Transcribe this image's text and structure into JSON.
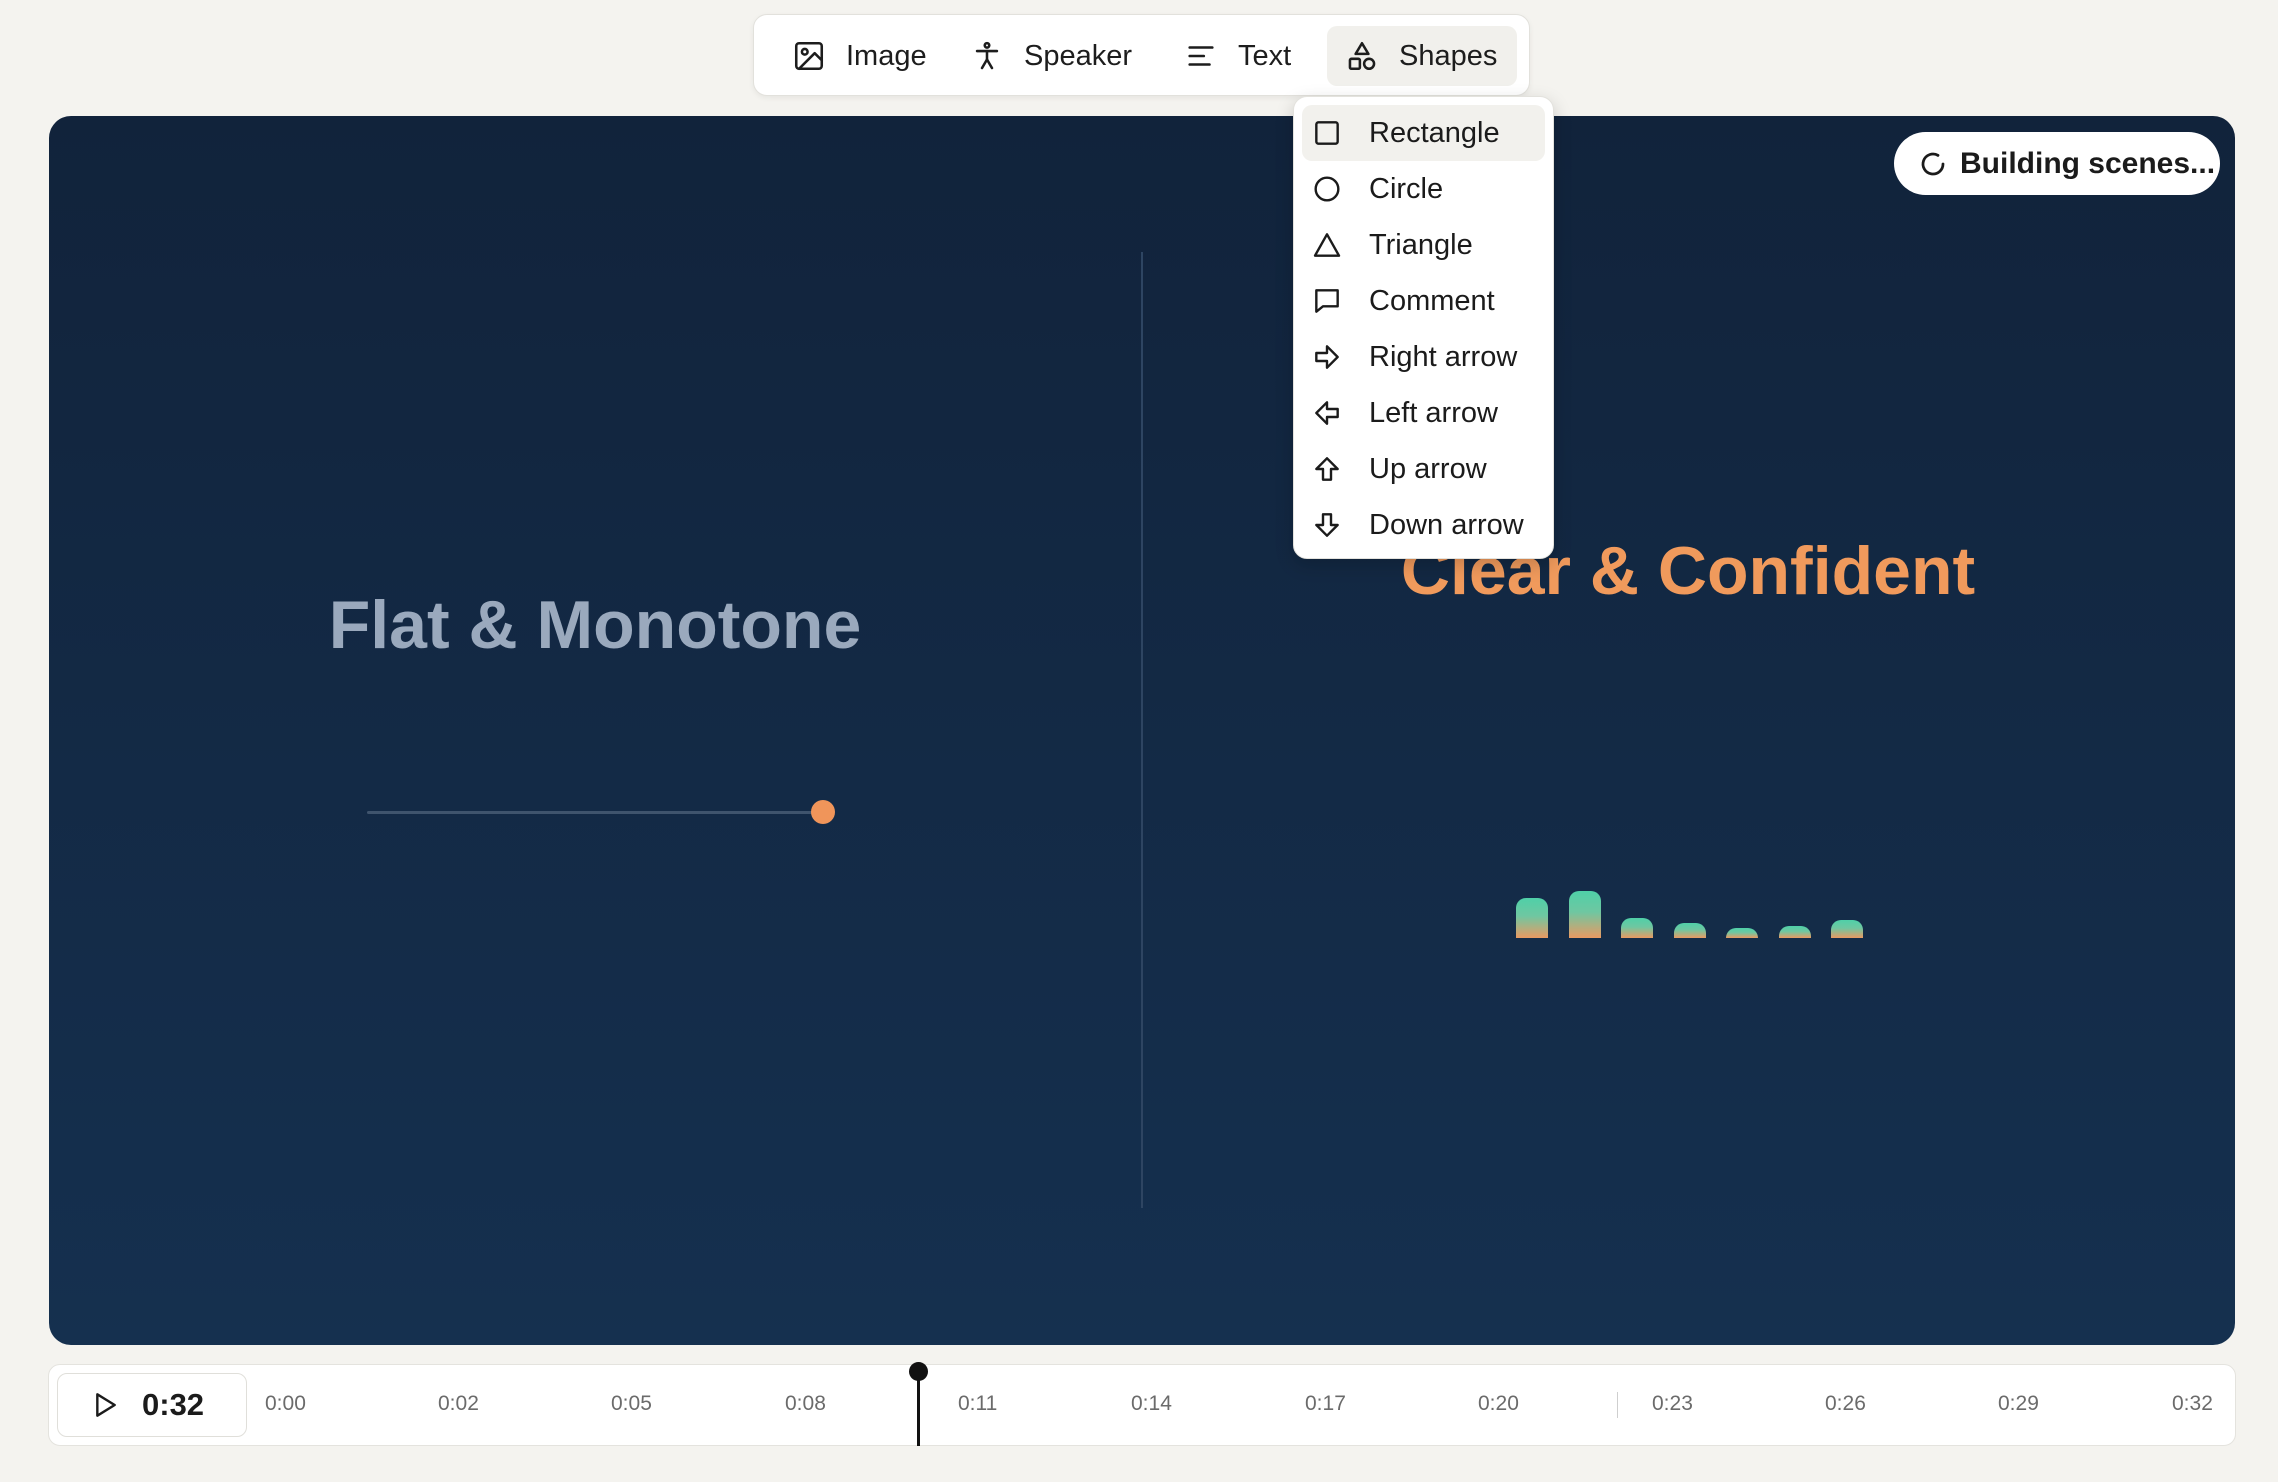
{
  "toolbar": {
    "image_label": "Image",
    "speaker_label": "Speaker",
    "text_label": "Text",
    "shapes_label": "Shapes"
  },
  "scene": {
    "left_title": "Flat & Monotone",
    "right_title": "Clear & Confident",
    "status": "Building scenes..."
  },
  "waveform": {
    "levels": [
      0.72,
      0.85,
      0.36,
      0.28,
      0.16,
      0.22,
      0.33
    ]
  },
  "shapes_menu": {
    "items": [
      {
        "label": "Rectangle",
        "icon": "rectangle-icon"
      },
      {
        "label": "Circle",
        "icon": "circle-icon"
      },
      {
        "label": "Triangle",
        "icon": "triangle-icon"
      },
      {
        "label": "Comment",
        "icon": "comment-icon"
      },
      {
        "label": "Right arrow",
        "icon": "right-arrow-icon"
      },
      {
        "label": "Left arrow",
        "icon": "left-arrow-icon"
      },
      {
        "label": "Up arrow",
        "icon": "up-arrow-icon"
      },
      {
        "label": "Down arrow",
        "icon": "down-arrow-icon"
      }
    ]
  },
  "timeline": {
    "current_time": "0:32",
    "ticks": [
      "0:00",
      "0:02",
      "0:05",
      "0:08",
      "0:11",
      "0:14",
      "0:17",
      "0:20",
      "0:23",
      "0:26",
      "0:29",
      "0:32"
    ]
  },
  "colors": {
    "accent_orange": "#f09a5c",
    "muted_title": "#9aa9bd",
    "scene_bg": "#11233b",
    "bar_top": "#4fd0a8"
  }
}
